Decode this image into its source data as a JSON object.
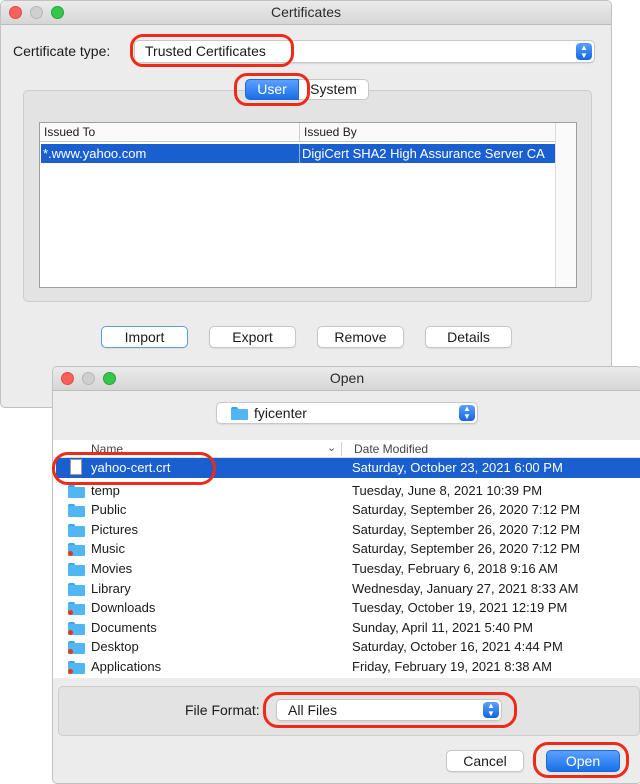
{
  "certificates": {
    "title": "Certificates",
    "type_label": "Certificate type:",
    "type_value": "Trusted Certificates",
    "tabs": [
      {
        "label": "User",
        "selected": true
      },
      {
        "label": "System",
        "selected": false
      }
    ],
    "columns": [
      "Issued To",
      "Issued By"
    ],
    "rows": [
      {
        "issued_to": "*.www.yahoo.com",
        "issued_by": "DigiCert SHA2 High Assurance Server CA",
        "selected": true
      }
    ],
    "buttons": {
      "import": "Import",
      "export": "Export",
      "remove": "Remove",
      "details": "Details"
    }
  },
  "open_dialog": {
    "title": "Open",
    "location": "fyicenter",
    "columns": {
      "name": "Name",
      "date": "Date Modified"
    },
    "files": [
      {
        "name": "yahoo-cert.crt",
        "date": "Saturday, October 23, 2021 6:00 PM",
        "icon": "file-icon",
        "selected": true
      },
      {
        "name": "temp",
        "date": "Tuesday, June 8, 2021 10:39 PM",
        "icon": "folder-icon"
      },
      {
        "name": "Public",
        "date": "Saturday, September 26, 2020 7:12 PM",
        "icon": "folder-icon"
      },
      {
        "name": "Pictures",
        "date": "Saturday, September 26, 2020 7:12 PM",
        "icon": "folder-icon"
      },
      {
        "name": "Music",
        "date": "Saturday, September 26, 2020 7:12 PM",
        "icon": "folder-icon",
        "badge": true
      },
      {
        "name": "Movies",
        "date": "Tuesday, February 6, 2018 9:16 AM",
        "icon": "folder-icon"
      },
      {
        "name": "Library",
        "date": "Wednesday, January 27, 2021 8:33 AM",
        "icon": "folder-icon"
      },
      {
        "name": "Downloads",
        "date": "Tuesday, October 19, 2021 12:19 PM",
        "icon": "folder-icon",
        "badge": true
      },
      {
        "name": "Documents",
        "date": "Sunday, April 11, 2021 5:40 PM",
        "icon": "folder-icon",
        "badge": true
      },
      {
        "name": "Desktop",
        "date": "Saturday, October 16, 2021 4:44 PM",
        "icon": "folder-icon",
        "badge": true
      },
      {
        "name": "Applications",
        "date": "Friday, February 19, 2021 8:38 AM",
        "icon": "folder-icon",
        "badge": true
      }
    ],
    "format_label": "File Format:",
    "format_value": "All Files",
    "cancel": "Cancel",
    "open": "Open"
  },
  "colors": {
    "selection": "#1a5fd0",
    "accent": "#1a6fe8",
    "callout": "#ee2b17"
  }
}
